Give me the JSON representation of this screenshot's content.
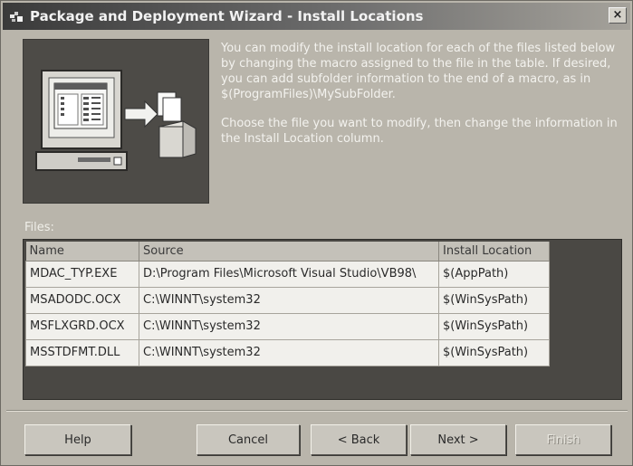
{
  "window": {
    "title": "Package and Deployment Wizard - Install Locations",
    "close_glyph": "×"
  },
  "description": {
    "paragraph1": "You can modify the install location for each of the files listed below by changing the macro assigned to the file in the table. If desired, you can add subfolder information to the end of a macro, as in $(ProgramFiles)\\MySubFolder.",
    "paragraph2": "Choose the file you want to modify, then change the information in the Install Location column."
  },
  "files": {
    "label": "Files:",
    "columns": [
      "Name",
      "Source",
      "Install Location"
    ],
    "rows": [
      [
        "MDAC_TYP.EXE",
        "D:\\Program Files\\Microsoft Visual Studio\\VB98\\",
        "$(AppPath)"
      ],
      [
        "MSADODC.OCX",
        "C:\\WINNT\\system32",
        "$(WinSysPath)"
      ],
      [
        "MSFLXGRD.OCX",
        "C:\\WINNT\\system32",
        "$(WinSysPath)"
      ],
      [
        "MSSTDFMT.DLL",
        "C:\\WINNT\\system32",
        "$(WinSysPath)"
      ]
    ]
  },
  "buttons": {
    "help": "Help",
    "cancel": "Cancel",
    "back": "< Back",
    "next": "Next >",
    "finish": "Finish"
  },
  "icons": {
    "app": "wizard-app-icon",
    "illustration": "computer-package-illustration"
  },
  "colors": {
    "title_bar": "#3a3a3a",
    "dialog_bg": "#b9b5ab",
    "grid_bg": "#4a4844",
    "cell_bg": "#f1f0ec"
  }
}
